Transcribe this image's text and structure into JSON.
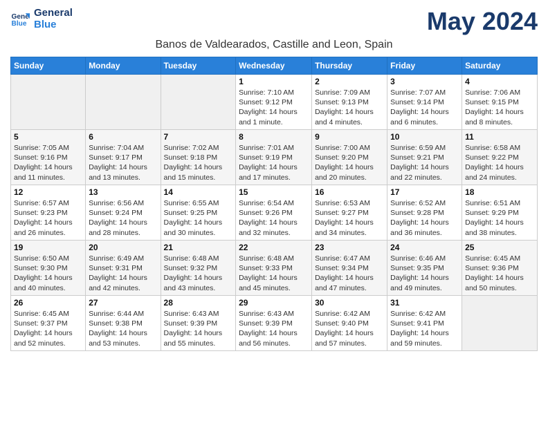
{
  "logo": {
    "line1": "General",
    "line2": "Blue"
  },
  "title": "May 2024",
  "subtitle": "Banos de Valdearados, Castille and Leon, Spain",
  "columns": [
    "Sunday",
    "Monday",
    "Tuesday",
    "Wednesday",
    "Thursday",
    "Friday",
    "Saturday"
  ],
  "weeks": [
    [
      {
        "day": "",
        "info": ""
      },
      {
        "day": "",
        "info": ""
      },
      {
        "day": "",
        "info": ""
      },
      {
        "day": "1",
        "info": "Sunrise: 7:10 AM\nSunset: 9:12 PM\nDaylight: 14 hours\nand 1 minute."
      },
      {
        "day": "2",
        "info": "Sunrise: 7:09 AM\nSunset: 9:13 PM\nDaylight: 14 hours\nand 4 minutes."
      },
      {
        "day": "3",
        "info": "Sunrise: 7:07 AM\nSunset: 9:14 PM\nDaylight: 14 hours\nand 6 minutes."
      },
      {
        "day": "4",
        "info": "Sunrise: 7:06 AM\nSunset: 9:15 PM\nDaylight: 14 hours\nand 8 minutes."
      }
    ],
    [
      {
        "day": "5",
        "info": "Sunrise: 7:05 AM\nSunset: 9:16 PM\nDaylight: 14 hours\nand 11 minutes."
      },
      {
        "day": "6",
        "info": "Sunrise: 7:04 AM\nSunset: 9:17 PM\nDaylight: 14 hours\nand 13 minutes."
      },
      {
        "day": "7",
        "info": "Sunrise: 7:02 AM\nSunset: 9:18 PM\nDaylight: 14 hours\nand 15 minutes."
      },
      {
        "day": "8",
        "info": "Sunrise: 7:01 AM\nSunset: 9:19 PM\nDaylight: 14 hours\nand 17 minutes."
      },
      {
        "day": "9",
        "info": "Sunrise: 7:00 AM\nSunset: 9:20 PM\nDaylight: 14 hours\nand 20 minutes."
      },
      {
        "day": "10",
        "info": "Sunrise: 6:59 AM\nSunset: 9:21 PM\nDaylight: 14 hours\nand 22 minutes."
      },
      {
        "day": "11",
        "info": "Sunrise: 6:58 AM\nSunset: 9:22 PM\nDaylight: 14 hours\nand 24 minutes."
      }
    ],
    [
      {
        "day": "12",
        "info": "Sunrise: 6:57 AM\nSunset: 9:23 PM\nDaylight: 14 hours\nand 26 minutes."
      },
      {
        "day": "13",
        "info": "Sunrise: 6:56 AM\nSunset: 9:24 PM\nDaylight: 14 hours\nand 28 minutes."
      },
      {
        "day": "14",
        "info": "Sunrise: 6:55 AM\nSunset: 9:25 PM\nDaylight: 14 hours\nand 30 minutes."
      },
      {
        "day": "15",
        "info": "Sunrise: 6:54 AM\nSunset: 9:26 PM\nDaylight: 14 hours\nand 32 minutes."
      },
      {
        "day": "16",
        "info": "Sunrise: 6:53 AM\nSunset: 9:27 PM\nDaylight: 14 hours\nand 34 minutes."
      },
      {
        "day": "17",
        "info": "Sunrise: 6:52 AM\nSunset: 9:28 PM\nDaylight: 14 hours\nand 36 minutes."
      },
      {
        "day": "18",
        "info": "Sunrise: 6:51 AM\nSunset: 9:29 PM\nDaylight: 14 hours\nand 38 minutes."
      }
    ],
    [
      {
        "day": "19",
        "info": "Sunrise: 6:50 AM\nSunset: 9:30 PM\nDaylight: 14 hours\nand 40 minutes."
      },
      {
        "day": "20",
        "info": "Sunrise: 6:49 AM\nSunset: 9:31 PM\nDaylight: 14 hours\nand 42 minutes."
      },
      {
        "day": "21",
        "info": "Sunrise: 6:48 AM\nSunset: 9:32 PM\nDaylight: 14 hours\nand 43 minutes."
      },
      {
        "day": "22",
        "info": "Sunrise: 6:48 AM\nSunset: 9:33 PM\nDaylight: 14 hours\nand 45 minutes."
      },
      {
        "day": "23",
        "info": "Sunrise: 6:47 AM\nSunset: 9:34 PM\nDaylight: 14 hours\nand 47 minutes."
      },
      {
        "day": "24",
        "info": "Sunrise: 6:46 AM\nSunset: 9:35 PM\nDaylight: 14 hours\nand 49 minutes."
      },
      {
        "day": "25",
        "info": "Sunrise: 6:45 AM\nSunset: 9:36 PM\nDaylight: 14 hours\nand 50 minutes."
      }
    ],
    [
      {
        "day": "26",
        "info": "Sunrise: 6:45 AM\nSunset: 9:37 PM\nDaylight: 14 hours\nand 52 minutes."
      },
      {
        "day": "27",
        "info": "Sunrise: 6:44 AM\nSunset: 9:38 PM\nDaylight: 14 hours\nand 53 minutes."
      },
      {
        "day": "28",
        "info": "Sunrise: 6:43 AM\nSunset: 9:39 PM\nDaylight: 14 hours\nand 55 minutes."
      },
      {
        "day": "29",
        "info": "Sunrise: 6:43 AM\nSunset: 9:39 PM\nDaylight: 14 hours\nand 56 minutes."
      },
      {
        "day": "30",
        "info": "Sunrise: 6:42 AM\nSunset: 9:40 PM\nDaylight: 14 hours\nand 57 minutes."
      },
      {
        "day": "31",
        "info": "Sunrise: 6:42 AM\nSunset: 9:41 PM\nDaylight: 14 hours\nand 59 minutes."
      },
      {
        "day": "",
        "info": ""
      }
    ]
  ]
}
